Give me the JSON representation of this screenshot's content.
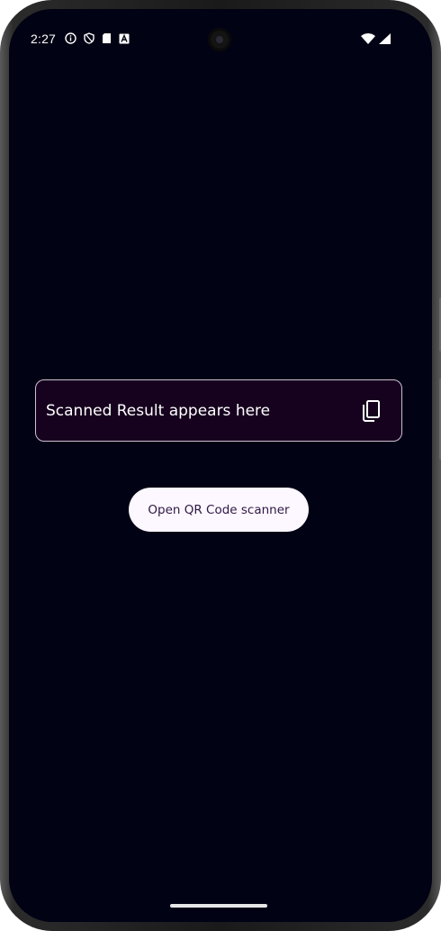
{
  "status_bar": {
    "time": "2:27",
    "left_icons": [
      "info-icon",
      "shield-icon",
      "sd-card-icon",
      "font-a-icon"
    ],
    "right_icons": [
      "wifi-icon",
      "cell-signal-icon"
    ]
  },
  "result_field": {
    "placeholder_text": "Scanned Result appears here",
    "copy_icon": "copy-icon"
  },
  "actions": {
    "scan_button_label": "Open QR Code scanner"
  },
  "colors": {
    "background": "#010214",
    "result_box_bg": "#16021e",
    "result_box_border": "#cdbfd4",
    "button_bg": "#fdf7ff",
    "button_text": "#2d1844"
  }
}
